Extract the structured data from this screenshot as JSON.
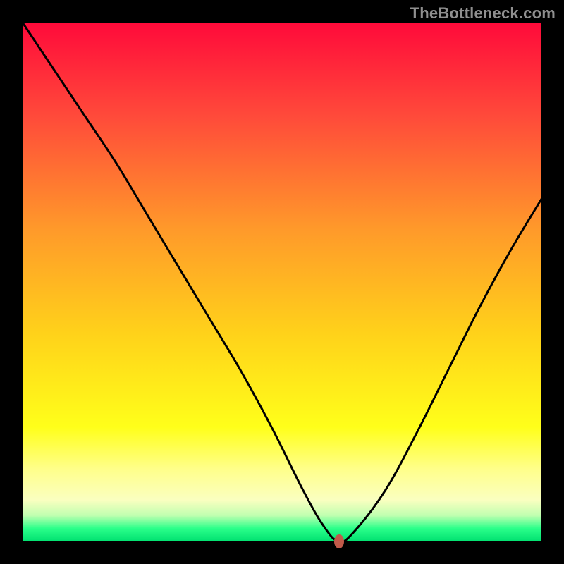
{
  "watermark": "TheBottleneck.com",
  "colors": {
    "page_bg": "#000000",
    "gradient_top": "#ff0a3a",
    "gradient_bottom": "#00e070",
    "curve": "#000000",
    "marker": "#c05a4a",
    "watermark": "#8f8f8f"
  },
  "chart_data": {
    "type": "line",
    "title": "",
    "xlabel": "",
    "ylabel": "",
    "xlim": [
      0,
      100
    ],
    "ylim": [
      0,
      100
    ],
    "grid": false,
    "series": [
      {
        "name": "bottleneck-curve",
        "x": [
          0,
          6,
          12,
          18,
          24,
          30,
          36,
          42,
          48,
          54,
          58,
          61,
          64,
          70,
          76,
          82,
          88,
          94,
          100
        ],
        "y": [
          100,
          91,
          82,
          73,
          63,
          53,
          43,
          33,
          22,
          10,
          3,
          0,
          2,
          10,
          21,
          33,
          45,
          56,
          66
        ]
      }
    ],
    "marker": {
      "x": 61,
      "y": 0
    }
  }
}
